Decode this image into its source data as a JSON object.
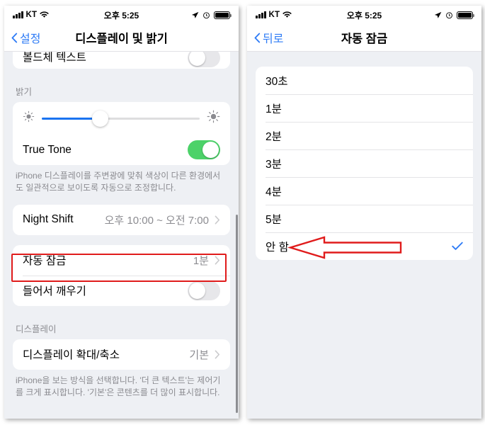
{
  "status_bar": {
    "carrier": "KT",
    "time": "오후 5:25",
    "icons": [
      "signal-bars-icon",
      "wifi-icon",
      "location-arrow-icon",
      "alarm-clock-icon",
      "battery-icon"
    ]
  },
  "left_panel": {
    "nav": {
      "back_label": "설정",
      "title": "디스플레이 및 밝기"
    },
    "top_group": {
      "rows": [
        {
          "label": "볼드체 텍스트",
          "control": "toggle",
          "state": "off"
        }
      ]
    },
    "brightness_section": {
      "header": "밝기",
      "slider": {
        "value_percent": 37,
        "min_icon": "sun-small-icon",
        "max_icon": "sun-large-icon"
      },
      "rows": [
        {
          "label": "True Tone",
          "control": "toggle",
          "state": "on"
        }
      ],
      "footnote": "iPhone 디스플레이를 주변광에 맞춰 색상이 다른 환경에서도 일관적으로 보이도록 자동으로 조정합니다."
    },
    "night_shift_group": {
      "rows": [
        {
          "label": "Night Shift",
          "value": "오후 10:00 ~ 오전 7:00",
          "accessory": "chevron-right-icon"
        }
      ]
    },
    "lock_group": {
      "rows": [
        {
          "label": "자동 잠금",
          "value": "1분",
          "accessory": "chevron-right-icon",
          "highlighted": true
        },
        {
          "label": "들어서 깨우기",
          "control": "toggle",
          "state": "off"
        }
      ]
    },
    "display_section": {
      "header": "디스플레이",
      "rows": [
        {
          "label": "디스플레이 확대/축소",
          "value": "기본",
          "accessory": "chevron-right-icon"
        }
      ],
      "footnote": "iPhone을 보는 방식을 선택합니다. '더 큰 텍스트'는 제어기를 크게 표시합니다. '기본'은 콘텐츠를 더 많이 표시합니다."
    }
  },
  "right_panel": {
    "nav": {
      "back_label": "뒤로",
      "title": "자동 잠금"
    },
    "options": [
      {
        "label": "30초",
        "selected": false
      },
      {
        "label": "1분",
        "selected": false
      },
      {
        "label": "2분",
        "selected": false
      },
      {
        "label": "3분",
        "selected": false
      },
      {
        "label": "4분",
        "selected": false
      },
      {
        "label": "5분",
        "selected": false
      },
      {
        "label": "안 함",
        "selected": true
      }
    ],
    "selected_accessory": "checkmark-icon"
  },
  "annotations": {
    "highlight_color": "#e01b1b",
    "arrow": {
      "shape": "left-pointing-arrow-outline",
      "target": "안 함"
    },
    "accent_blue": "#2f7cf6",
    "toggle_green": "#4cd269",
    "slider_blue": "#1a73f0"
  }
}
